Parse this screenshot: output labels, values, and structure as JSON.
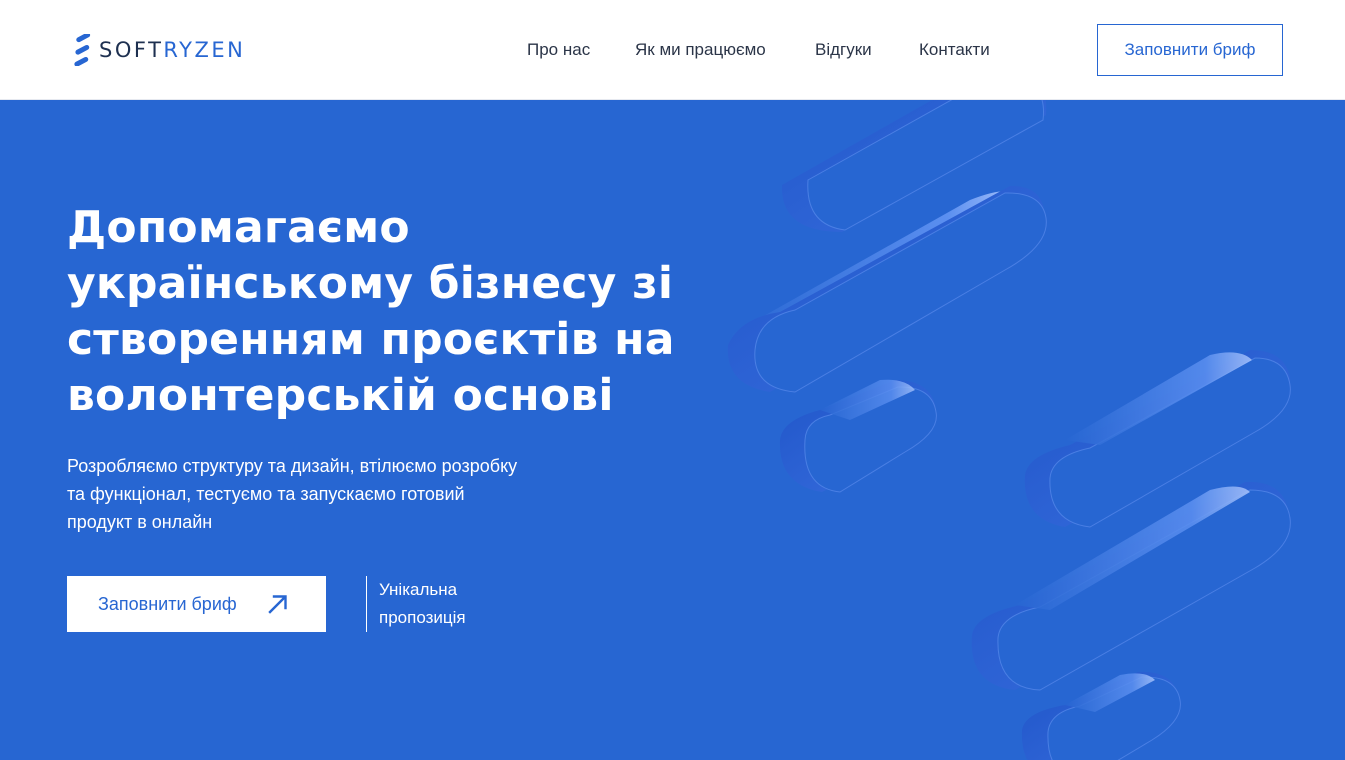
{
  "header": {
    "logo": {
      "text_main": "SOFT",
      "text_accent": "RYZEN"
    },
    "nav": [
      {
        "label": "Про нас"
      },
      {
        "label": "Як ми працюємо"
      },
      {
        "label": "Відгуки"
      },
      {
        "label": "Контакти"
      }
    ],
    "cta_label": "Заповнити бриф"
  },
  "hero": {
    "title_lines": [
      "Допомагаємо",
      "українському бізнесу зі",
      "створенням проєктів на",
      "волонтерській основі"
    ],
    "subtitle_lines": [
      "Розробляємо структуру та дизайн, втілюємо розробку",
      "та функціонал, тестуємо та запускаємо готовий",
      "продукт в онлайн"
    ],
    "cta_label": "Заповнити бриф",
    "unique_lines": [
      "Унікальна",
      "пропозиція"
    ]
  },
  "colors": {
    "brand_blue": "#2766d2",
    "dark_text": "#1e3050",
    "white": "#ffffff"
  },
  "icons": {
    "logo_mark": "softryzen-logo-icon",
    "cta_arrow": "arrow-up-right-icon"
  }
}
